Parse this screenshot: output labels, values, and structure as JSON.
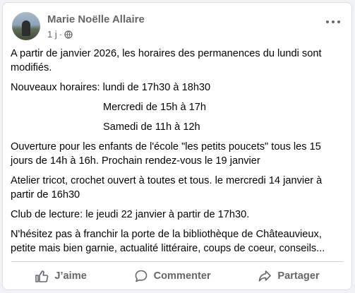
{
  "post": {
    "author": "Marie Noëlle Allaire",
    "time": "1 j",
    "time_separator": "·",
    "paragraphs": {
      "intro": "A partir de janvier 2026, les horaires des permanences du lundi sont modifiés.",
      "hours_1": "Nouveaux horaires: lundi de 17h30 à 18h30",
      "hours_2": "Mercredi de 15h à 17h",
      "hours_3": "Samedi de 11h à 12h",
      "kids": "Ouverture pour les enfants de l'école  \"les petits poucets\" tous les 15 jours de 14h à 16h. Prochain rendez-vous le 19 janvier",
      "knitting": "Atelier tricot, crochet ouvert à toutes et tous. le mercredi 14 janvier à partir de 16h30",
      "reading": "Club de lecture: le jeudi 22 janvier à partir de 17h30.",
      "closing": "N'hésitez pas à franchir la porte de la bibliothèque de Châteauvieux, petite mais bien garnie, actualité littéraire, coups de coeur, conseils..."
    }
  },
  "actions": {
    "like": "J’aime",
    "comment": "Commenter",
    "share": "Partager"
  },
  "icons": {
    "avatar": "profile-photo",
    "privacy": "globe-icon",
    "menu": "more-options-icon",
    "like": "thumbs-up-icon",
    "comment": "speech-bubble-icon",
    "share": "share-arrow-icon"
  },
  "colors": {
    "text": "#050505",
    "secondary": "#65676b",
    "card": "#ffffff",
    "background": "#f0f2f5"
  }
}
